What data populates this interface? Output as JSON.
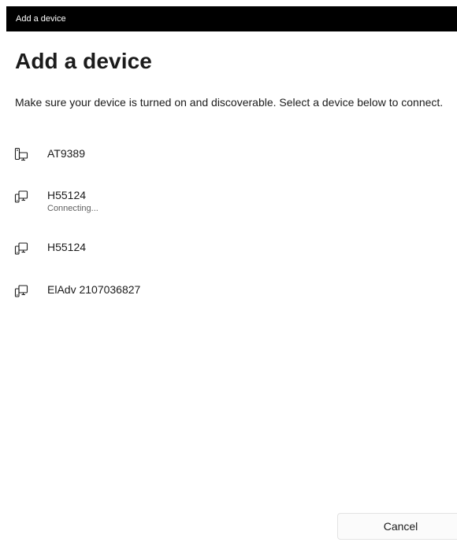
{
  "window": {
    "title": "Add a device"
  },
  "main": {
    "heading": "Add a device",
    "description": "Make sure your device is turned on and discoverable. Select a device below to connect."
  },
  "devices": [
    {
      "name": "AT9389",
      "status": "",
      "icon": "computer-device-icon"
    },
    {
      "name": "H55124",
      "status": "Connecting...",
      "icon": "display-device-icon"
    },
    {
      "name": "H55124",
      "status": "",
      "icon": "display-device-icon"
    },
    {
      "name": "ElAdv 2107036827",
      "status": "",
      "icon": "display-device-icon"
    }
  ],
  "footer": {
    "cancel_label": "Cancel"
  },
  "colors": {
    "titlebar_bg": "#000000",
    "titlebar_text": "#ffffff",
    "text_primary": "#1b1b1b",
    "text_secondary": "#5f5f5f"
  }
}
